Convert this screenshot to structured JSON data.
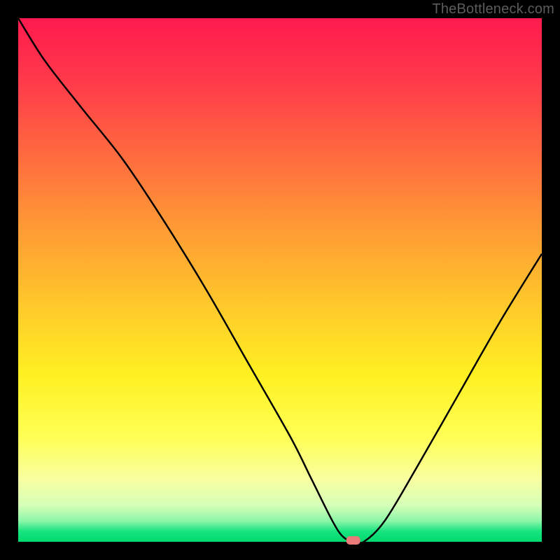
{
  "watermark": "TheBottleneck.com",
  "chart_data": {
    "type": "line",
    "title": "",
    "xlabel": "",
    "ylabel": "",
    "xlim": [
      0,
      100
    ],
    "ylim": [
      0,
      100
    ],
    "x": [
      0,
      5,
      12,
      20,
      28,
      36,
      44,
      52,
      56,
      60,
      62,
      64,
      66,
      70,
      76,
      84,
      92,
      100
    ],
    "values": [
      100,
      92,
      83,
      73,
      61,
      48,
      34,
      20,
      12,
      4,
      1,
      0,
      0,
      4,
      14,
      28,
      42,
      55
    ],
    "optimum_x": 64,
    "optimum_y": 0,
    "marker_color": "#e97a77",
    "background": "spectral-gradient"
  }
}
